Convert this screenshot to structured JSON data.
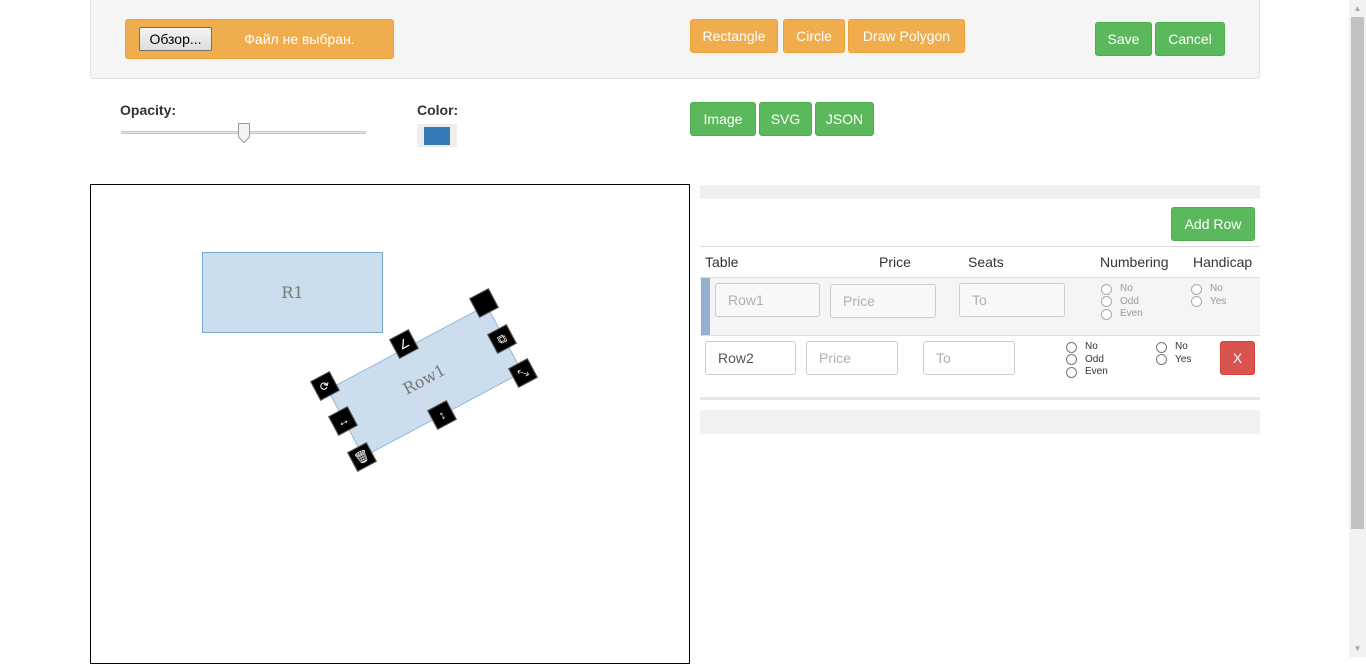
{
  "toolbar": {
    "file_button": "Обзор...",
    "file_status": "Файл не выбран.",
    "shape_buttons": [
      "Rectangle",
      "Circle",
      "Draw Polygon"
    ],
    "save_label": "Save",
    "cancel_label": "Cancel"
  },
  "controls": {
    "opacity_label": "Opacity:",
    "opacity_value": 0.5,
    "color_label": "Color:",
    "color_value": "#337ab7",
    "export_buttons": [
      "Image",
      "SVG",
      "JSON"
    ]
  },
  "canvas": {
    "shapes": [
      {
        "label": "R1"
      },
      {
        "label": "Row1"
      }
    ],
    "controls_icons": [
      "rotate-icon",
      "resize-horizontal-icon",
      "delete-icon",
      "resize-vertical-icon",
      "resize-diagonal-icon",
      "copy-icon",
      "edit-icon",
      "anchor-icon"
    ]
  },
  "table": {
    "add_row_label": "Add Row",
    "headers": [
      "Table",
      "Price",
      "Seats",
      "Numbering",
      "Handicap"
    ],
    "rows": [
      {
        "table_value": "",
        "table_placeholder": "Row1",
        "price_placeholder": "Price",
        "seats_placeholder": "To",
        "numbering": [
          "No",
          "Odd",
          "Even"
        ],
        "handicap": [
          "No",
          "Yes"
        ]
      },
      {
        "table_value": "Row2",
        "table_placeholder": "",
        "price_placeholder": "Price",
        "seats_placeholder": "To",
        "numbering": [
          "No",
          "Odd",
          "Even"
        ],
        "handicap": [
          "No",
          "Yes"
        ],
        "delete_label": "X"
      }
    ]
  },
  "colors": {
    "warning": "#f0ad4e",
    "success": "#5cb85c",
    "danger": "#d9534f",
    "primary": "#337ab7"
  }
}
